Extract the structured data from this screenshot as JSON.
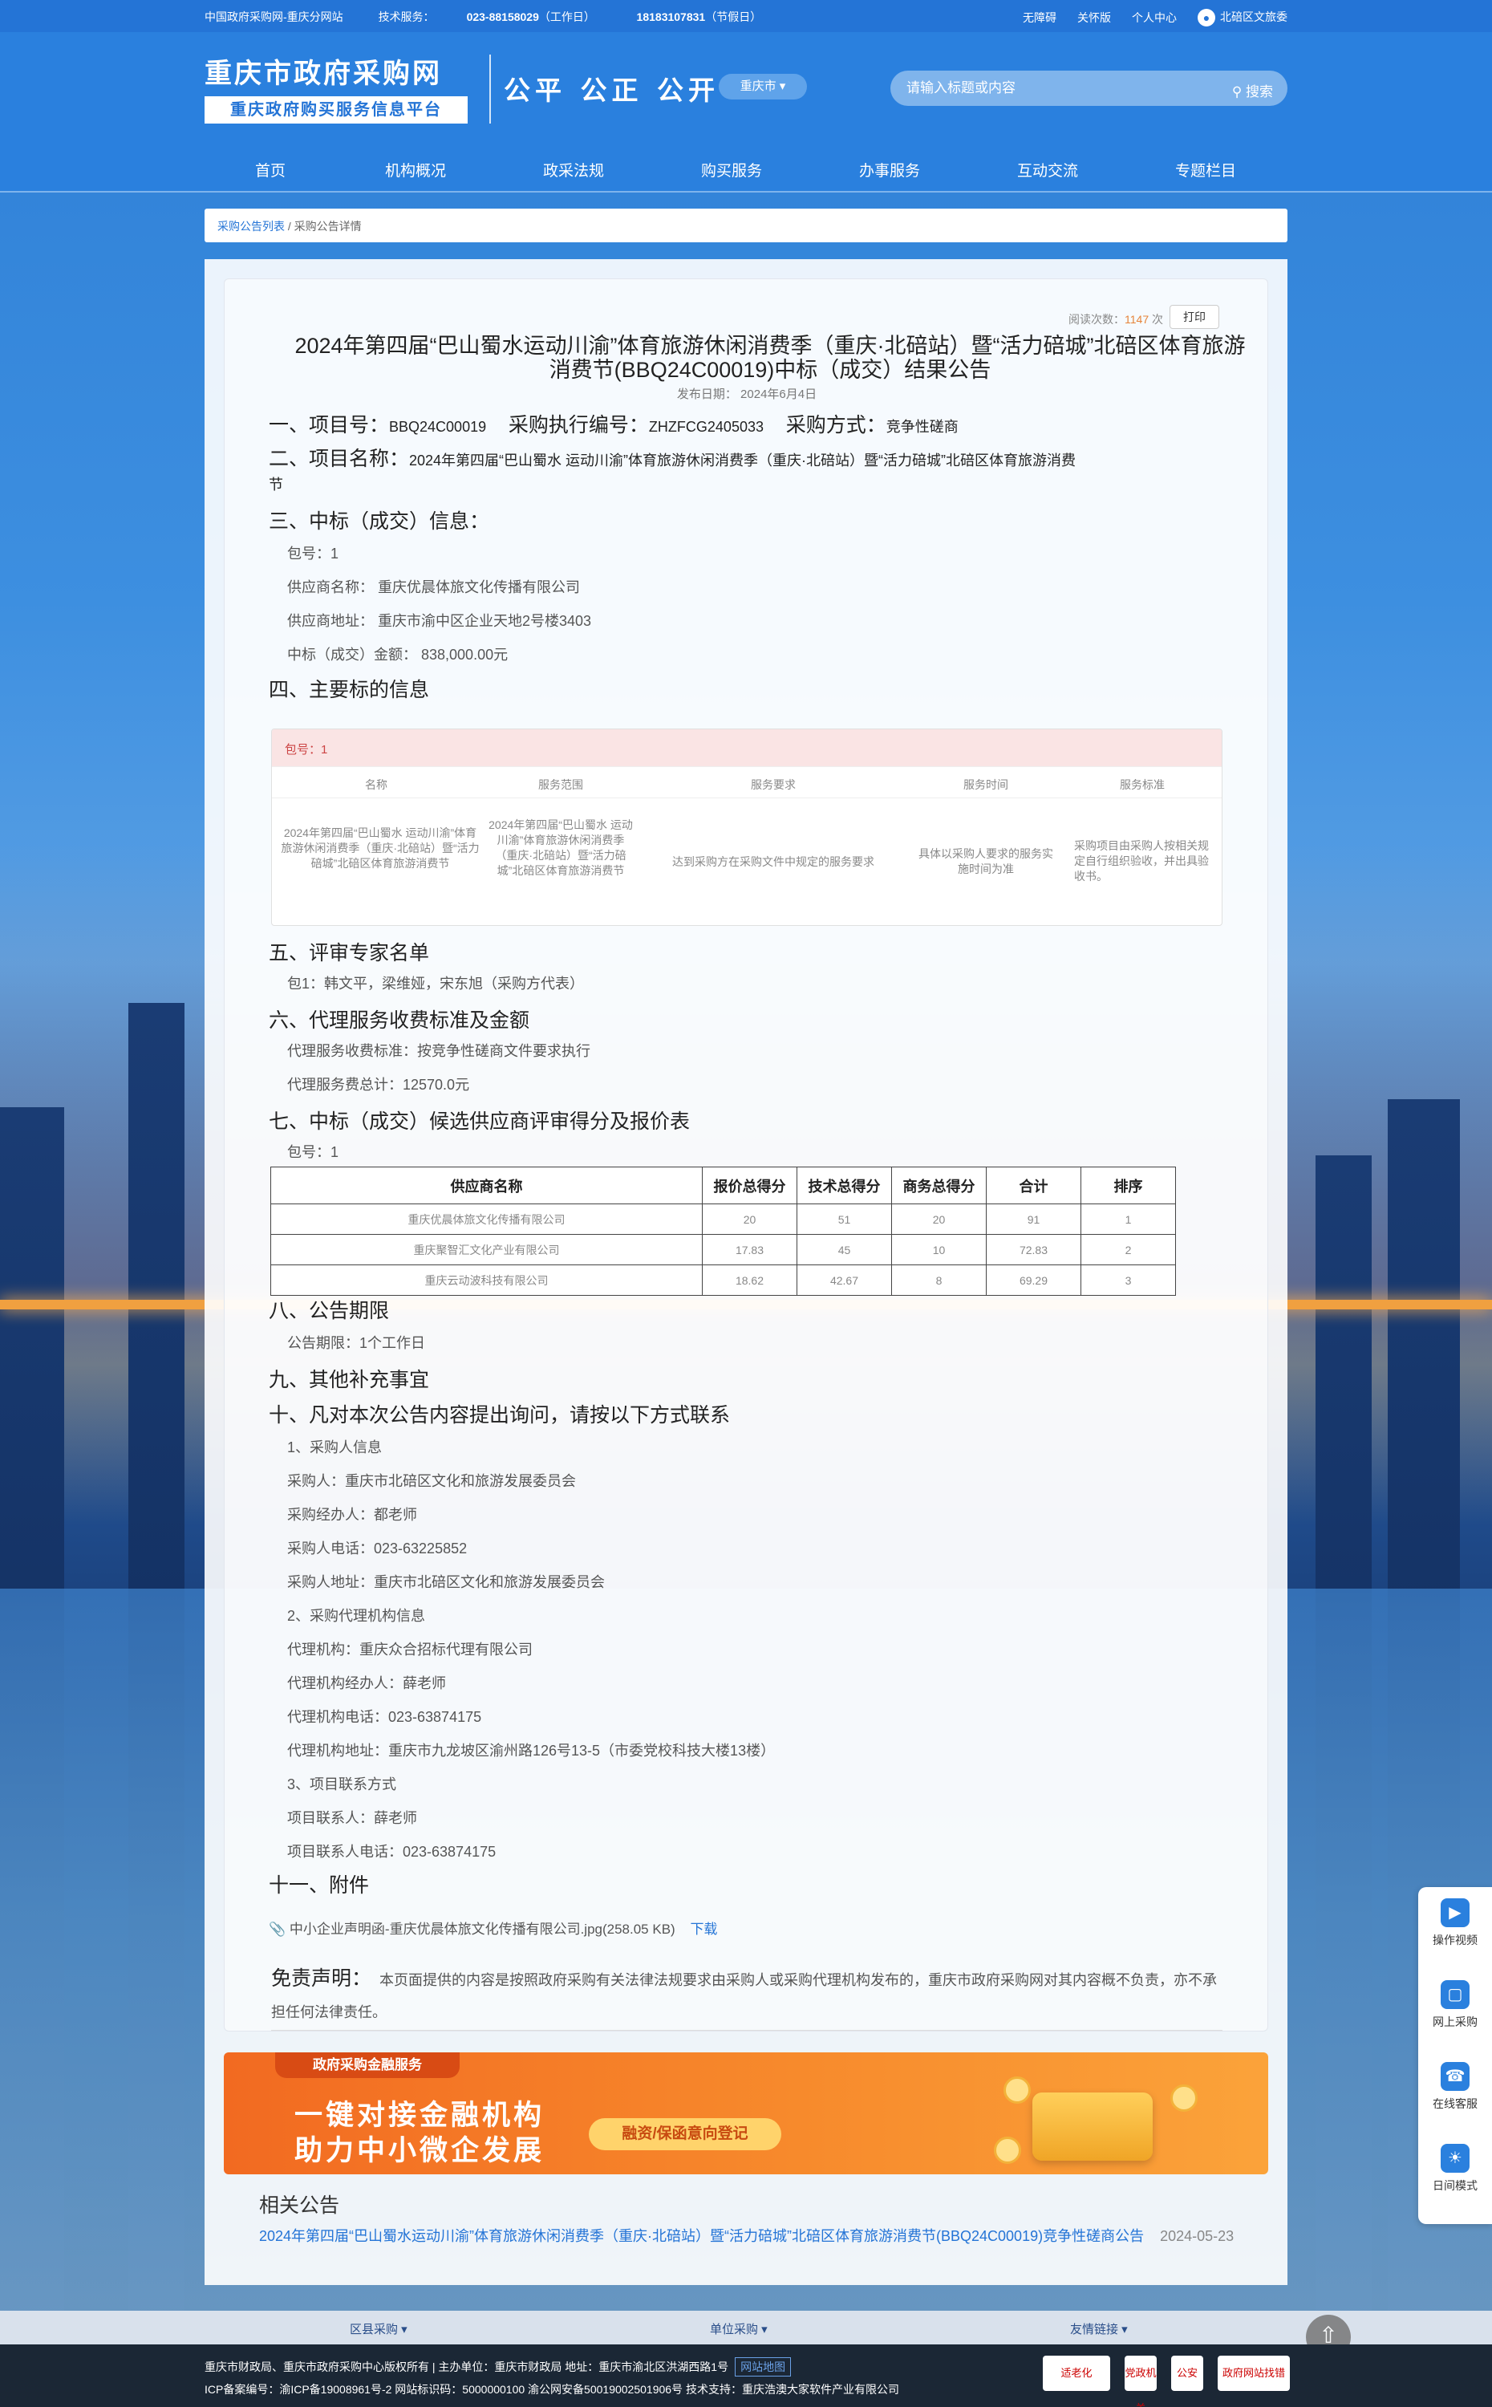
{
  "topbar": {
    "site": "中国政府采购网-重庆分网站",
    "tech_label": "技术服务：",
    "tech_phone1": "023-88158029",
    "tech_note1": "（工作日）",
    "tech_phone2": "18183107831",
    "tech_note2": "（节假日）",
    "links": [
      "无障碍",
      "关怀版",
      "个人中心"
    ],
    "user": "北碚区文旅委"
  },
  "header": {
    "logo_title": "重庆市政府采购网",
    "logo_subtitle": "重庆政府购买服务信息平台",
    "slogan": "公平 公正 公开",
    "region": "重庆市 ▾",
    "search_placeholder": "请输入标题或内容",
    "search_btn": "搜索"
  },
  "nav": [
    "首页",
    "机构概况",
    "政采法规",
    "购买服务",
    "办事服务",
    "互动交流",
    "专题栏目"
  ],
  "breadcrumb": {
    "item1": "采购公告列表",
    "sep": "/",
    "item2": "采购公告详情"
  },
  "notice": {
    "read_label": "阅读次数：",
    "read_count": "1147",
    "read_unit": "次",
    "print": "打印",
    "title": "2024年第四届“巴山蜀水运动川渝”体育旅游休闲消费季（重庆·北碚站）暨“活力碚城”北碚区体育旅游消费节(BBQ24C00019)中标（成交）结果公告",
    "pubdate": "发布日期： 2024年6月4日",
    "s1_label": "一、项目号：",
    "s1_value": "BBQ24C00019",
    "s1_label2": "采购执行编号：",
    "s1_value2": "ZHZFCG2405033",
    "s1_label3": "采购方式：",
    "s1_value3": "竞争性磋商",
    "s2_label": "二、项目名称：",
    "s2_value": "2024年第四届“巴山蜀水 运动川渝”体育旅游休闲消费季（重庆·北碚站）暨“活力碚城”北碚区体育旅游消费",
    "s2_value_cont": "节",
    "s3_h": "三、中标（成交）信息：",
    "s3_lines": [
      "包号：1",
      "供应商名称：  重庆优晨体旅文化传播有限公司",
      "供应商地址：  重庆市渝中区企业天地2号楼3403",
      "中标（成交）金额：  838,000.00元"
    ],
    "s4_h": "四、主要标的信息",
    "s4_pkg": "包号：1",
    "s4_headers": [
      "名称",
      "服务范围",
      "服务要求",
      "服务时间",
      "服务标准"
    ],
    "s4_row": [
      "2024年第四届“巴山蜀水 运动川渝”体育旅游休闲消费季（重庆·北碚站）暨“活力碚城”北碚区体育旅游消费节",
      "2024年第四届“巴山蜀水 运动川渝”体育旅游休闲消费季（重庆·北碚站）暨“活力碚城”北碚区体育旅游消费节",
      "达到采购方在采购文件中规定的服务要求",
      "具体以采购人要求的服务实施时间为准",
      "采购项目由采购人按相关规定自行组织验收，并出具验收书。"
    ],
    "s5_h": "五、评审专家名单",
    "s5_text": "包1：韩文平，梁维娅，宋东旭（采购方代表）",
    "s6_h": "六、代理服务收费标准及金额",
    "s6_lines": [
      "代理服务收费标准：按竞争性磋商文件要求执行",
      "代理服务费总计：12570.0元"
    ],
    "s7_h": "七、中标（成交）候选供应商评审得分及报价表",
    "s7_pkg": "包号：1",
    "s7_headers": [
      "供应商名称",
      "报价总得分",
      "技术总得分",
      "商务总得分",
      "合计",
      "排序"
    ],
    "s7_rows": [
      [
        "重庆优晨体旅文化传播有限公司",
        "20",
        "51",
        "20",
        "91",
        "1"
      ],
      [
        "重庆聚智汇文化产业有限公司",
        "17.83",
        "45",
        "10",
        "72.83",
        "2"
      ],
      [
        "重庆云动波科技有限公司",
        "18.62",
        "42.67",
        "8",
        "69.29",
        "3"
      ]
    ],
    "s8_h": "八、公告期限",
    "s8_text": "公告期限：1个工作日",
    "s9_h": "九、其他补充事宜",
    "s10_h": "十、凡对本次公告内容提出询问，请按以下方式联系",
    "s10_lines": [
      "1、采购人信息",
      "采购人：重庆市北碚区文化和旅游发展委员会",
      "采购经办人：都老师",
      "采购人电话：023-63225852",
      "采购人地址：重庆市北碚区文化和旅游发展委员会",
      "2、采购代理机构信息",
      "代理机构：重庆众合招标代理有限公司",
      "代理机构经办人：薛老师",
      "代理机构电话：023-63874175",
      "代理机构地址：重庆市九龙坡区渝州路126号13-5（市委党校科技大楼13楼）",
      "3、项目联系方式",
      "项目联系人：薛老师",
      "项目联系人电话：023-63874175"
    ],
    "s11_h": "十一、附件",
    "attachment": "中小企业声明函-重庆优晨体旅文化传播有限公司.jpg(258.05 KB)",
    "download": "下载",
    "disclaimer_k": "免责声明：",
    "disclaimer": "本页面提供的内容是按照政府采购有关法律法规要求由采购人或采购代理机构发布的，重庆市政府采购网对其内容概不负责，亦不承担任何法律责任。"
  },
  "banner": {
    "tag": "政府采购金融服务",
    "line1": "一键对接金融机构",
    "line2": "助力中小微企发展",
    "pill": "融资/保函意向登记"
  },
  "related": {
    "heading": "相关公告",
    "title": "2024年第四届“巴山蜀水运动川渝”体育旅游休闲消费季（重庆·北碚站）暨“活力碚城”北碚区体育旅游消费节(BBQ24C00019)竞争性磋商公告",
    "date": "2024-05-23"
  },
  "float": [
    "操作视频",
    "网上采购",
    "在线客服",
    "日间模式"
  ],
  "footer_tabs": [
    "区县采购 ▾",
    "单位采购 ▾",
    "友情链接 ▾"
  ],
  "footer": {
    "line1": "重庆市财政局、重庆市政府采购中心版权所有 | 主办单位：重庆市财政局 地址：重庆市渝北区洪湖西路1号",
    "sitemap": "网站地图",
    "line2": "ICP备案编号：渝ICP备19008961号-2 网站标识码：5000000100 渝公网安备50019002501906号 技术支持：重庆浩澳大家软件产业有限公司",
    "badges": [
      "适老化",
      "党政机关",
      "公安",
      "政府网站找错"
    ]
  }
}
